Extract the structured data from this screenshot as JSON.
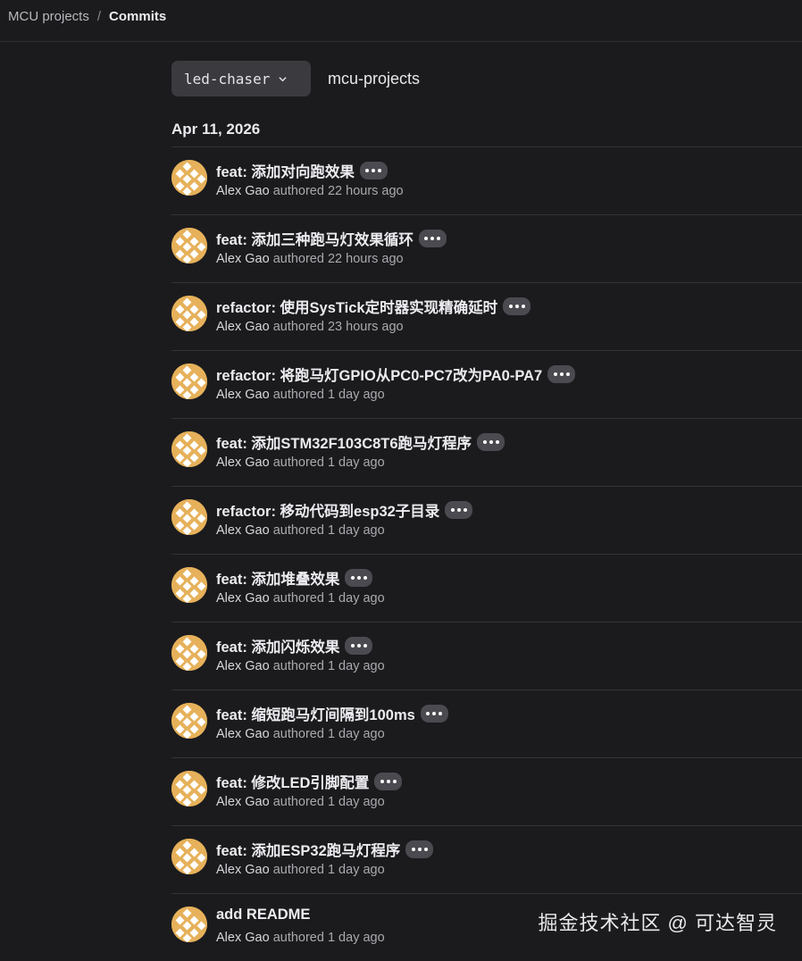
{
  "breadcrumb": {
    "project": "MCU projects",
    "separator": "/",
    "current": "Commits"
  },
  "branch": {
    "name": "led-chaser",
    "repo": "mcu-projects"
  },
  "date_header": "Apr 11, 2026",
  "commits": [
    {
      "title": "feat: 添加对向跑效果",
      "author": "Alex Gao",
      "verb": "authored",
      "time": "22 hours ago"
    },
    {
      "title": "feat: 添加三种跑马灯效果循环",
      "author": "Alex Gao",
      "verb": "authored",
      "time": "22 hours ago"
    },
    {
      "title": "refactor: 使用SysTick定时器实现精确延时",
      "author": "Alex Gao",
      "verb": "authored",
      "time": "23 hours ago"
    },
    {
      "title": "refactor: 将跑马灯GPIO从PC0-PC7改为PA0-PA7",
      "author": "Alex Gao",
      "verb": "authored",
      "time": "1 day ago"
    },
    {
      "title": "feat: 添加STM32F103C8T6跑马灯程序",
      "author": "Alex Gao",
      "verb": "authored",
      "time": "1 day ago"
    },
    {
      "title": "refactor: 移动代码到esp32子目录",
      "author": "Alex Gao",
      "verb": "authored",
      "time": "1 day ago"
    },
    {
      "title": "feat: 添加堆叠效果",
      "author": "Alex Gao",
      "verb": "authored",
      "time": "1 day ago"
    },
    {
      "title": "feat: 添加闪烁效果",
      "author": "Alex Gao",
      "verb": "authored",
      "time": "1 day ago"
    },
    {
      "title": "feat: 缩短跑马灯间隔到100ms",
      "author": "Alex Gao",
      "verb": "authored",
      "time": "1 day ago"
    },
    {
      "title": "feat: 修改LED引脚配置",
      "author": "Alex Gao",
      "verb": "authored",
      "time": "1 day ago"
    },
    {
      "title": "feat: 添加ESP32跑马灯程序",
      "author": "Alex Gao",
      "verb": "authored",
      "time": "1 day ago"
    },
    {
      "title": "add README",
      "author": "Alex Gao",
      "verb": "authored",
      "time": "1 day ago"
    }
  ],
  "watermark": "掘金技术社区 @ 可达智灵",
  "colors": {
    "background": "#1b1b1e",
    "avatar": "#e6b15a",
    "avatar_pattern": "#ffffff",
    "more_button": "#4a4a50",
    "branch_button": "#3a3a3f"
  },
  "icons": {
    "branch_dropdown": "chevron-down-icon",
    "more": "ellipsis-icon"
  }
}
